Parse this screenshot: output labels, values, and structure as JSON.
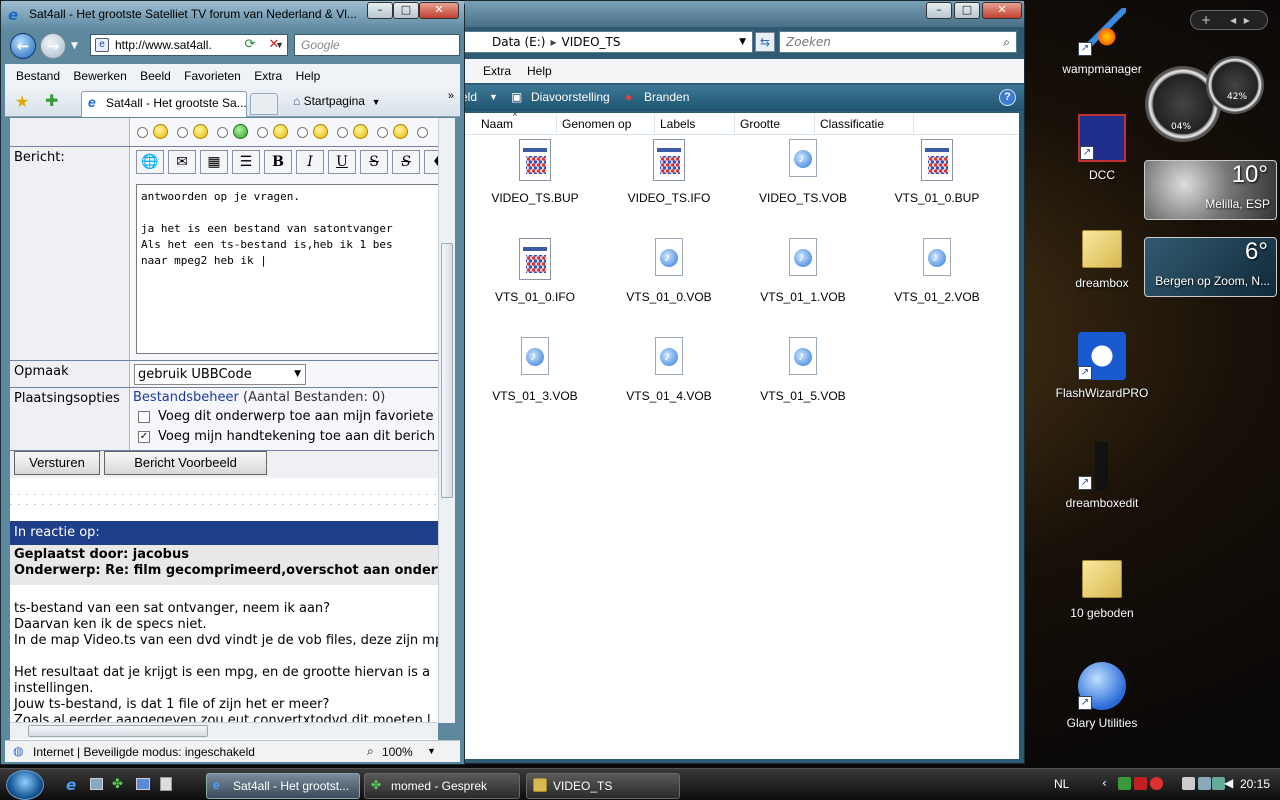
{
  "explorer": {
    "address_path": [
      "Data (E:)",
      "VIDEO_TS"
    ],
    "search_placeholder": "Zoeken",
    "menu": [
      "Extra",
      "Help"
    ],
    "cmd_fragment": "eld",
    "cmd": [
      "Diavoorstelling",
      "Branden"
    ],
    "help_label": "?",
    "columns": [
      "Naam",
      "Genomen op",
      "Labels",
      "Grootte",
      "Classificatie"
    ],
    "files": [
      {
        "name": "VIDEO_TS.BUP",
        "kind": "doc"
      },
      {
        "name": "VIDEO_TS.IFO",
        "kind": "doc"
      },
      {
        "name": "VIDEO_TS.VOB",
        "kind": "vob"
      },
      {
        "name": "VTS_01_0.BUP",
        "kind": "doc"
      },
      {
        "name": "VTS_01_0.IFO",
        "kind": "doc"
      },
      {
        "name": "VTS_01_0.VOB",
        "kind": "vob"
      },
      {
        "name": "VTS_01_1.VOB",
        "kind": "vob"
      },
      {
        "name": "VTS_01_2.VOB",
        "kind": "vob"
      },
      {
        "name": "VTS_01_3.VOB",
        "kind": "vob"
      },
      {
        "name": "VTS_01_4.VOB",
        "kind": "vob"
      },
      {
        "name": "VTS_01_5.VOB",
        "kind": "vob"
      }
    ]
  },
  "ie": {
    "title": "Sat4all - Het grootste Satelliet TV forum van Nederland & Vl...",
    "address": "http://www.sat4all.",
    "search_placeholder": "Google",
    "menu": [
      "Bestand",
      "Bewerken",
      "Beeld",
      "Favorieten",
      "Extra",
      "Help"
    ],
    "tab_title": "Sat4all - Het grootste Sa...",
    "home_label": "Startpagina",
    "status_text": "Internet | Beveiligde modus: ingeschakeld",
    "zoom": "100%"
  },
  "form": {
    "label_bericht": "Bericht:",
    "editor_text": "antwoorden op je vragen.\n\nja het is een bestand van satontvanger\nAls het een ts-bestand is,heb ik 1 bes\nnaar mpeg2 heb ik |",
    "label_opmaak": "Opmaak",
    "opmaak_value": "gebruik UBBCode",
    "label_plaatsing": "Plaatsingsopties",
    "bestandsbeheer_link": "Bestandsbeheer",
    "bestanden_count": " (Aantal Bestanden: 0)",
    "option_favorieten": "Voeg dit onderwerp toe aan mijn favoriete",
    "option_handtekening": "Voeg mijn handtekening toe aan dit berich",
    "btn_versturen": "Versturen",
    "btn_voorbeeld": "Bericht Voorbeeld",
    "format_buttons": [
      "B",
      "I",
      "U",
      "S",
      "S"
    ]
  },
  "quote": {
    "header": "In reactie op:",
    "posted_by": "Geplaatst door: jacobus",
    "subject": "Onderwerp: Re: film gecomprimeerd,overschot aan ondert",
    "lines": [
      "ts-bestand van een sat ontvanger, neem ik aan?",
      "Daarvan ken ik de specs niet.",
      "In de map Video.ts van een dvd vindt je de vob files, deze zijn mpe",
      "",
      "Het resultaat dat je krijgt is een mpg, en de grootte hiervan is a",
      "instellingen.",
      "Jouw ts-bestand, is dat 1 file of zijn het er meer?",
      "Zoals al eerder aangegeven zou eut convertxtodvd dit moeten l"
    ]
  },
  "desktop": {
    "icons": [
      "wampmanager",
      "DCC",
      "dreambox",
      "FlashWizardPRO",
      "dreamboxedit",
      "10 geboden",
      "Glary Utilities"
    ],
    "gauge_cpu": "04%",
    "gauge_mem": "42%",
    "weather1": {
      "temp": "10°",
      "city": "Melilla, ESP"
    },
    "weather2": {
      "temp": "6°",
      "city": "Bergen op Zoom, N..."
    }
  },
  "taskbar": {
    "items": [
      "Sat4all - Het grootst...",
      "momed - Gesprek",
      "VIDEO_TS"
    ],
    "lang": "NL",
    "clock": "20:15"
  },
  "colors": {
    "ie_chrome": "#5e889e",
    "explorer_cmdbar": "#2a6684",
    "quote_header": "#1f3f8a",
    "link": "#1a3aa0"
  }
}
